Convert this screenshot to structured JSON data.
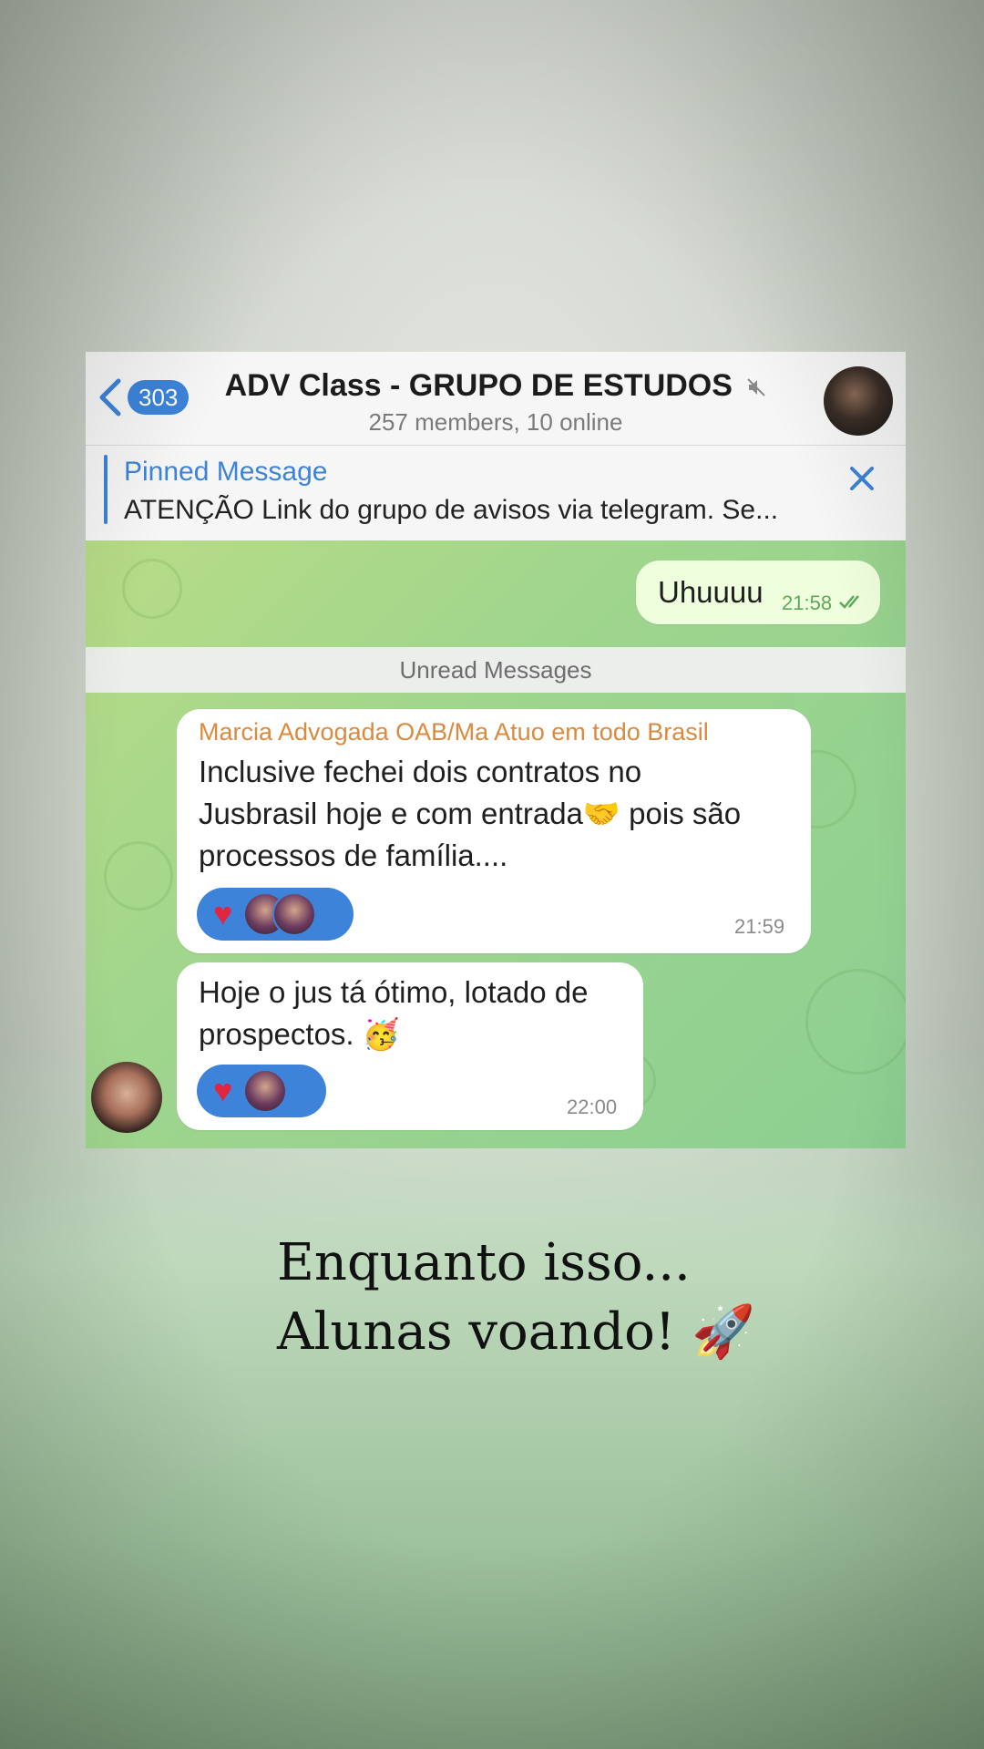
{
  "header": {
    "back_count": "303",
    "title": "ADV Class - GRUPO DE ESTUDOS",
    "subtitle": "257 members, 10 online"
  },
  "pinned": {
    "title": "Pinned Message",
    "text": "ATENÇÃO    Link do grupo de avisos via telegram. Se..."
  },
  "messages": {
    "outgoing": {
      "text": "Uhuuuu",
      "time": "21:58"
    },
    "separator": "Unread Messages",
    "msg1": {
      "sender": "Marcia Advogada OAB/Ma Atuo em todo Brasil",
      "line1": "Inclusive fechei dois contratos no",
      "line2": "Jusbrasil hoje e com entrada🤝 pois são",
      "line3": "processos de família....",
      "time": "21:59",
      "reaction": "♥"
    },
    "msg2": {
      "line1": "Hoje o jus tá ótimo, lotado de",
      "line2": "prospectos. 🥳",
      "time": "22:00",
      "reaction": "♥"
    }
  },
  "caption": {
    "line1": "Enquanto isso...",
    "line2": "Alunas voando! 🚀"
  },
  "colors": {
    "accent": "#3c83d9",
    "sender": "#d98a3f",
    "heart": "#e0263f"
  }
}
